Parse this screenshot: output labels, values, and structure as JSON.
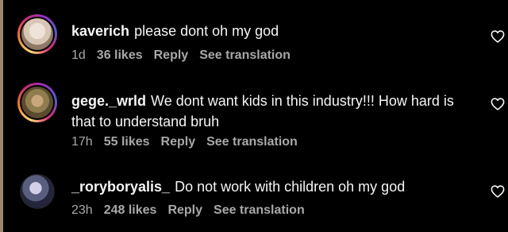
{
  "comments": [
    {
      "username": "kaverich",
      "text": "please dont oh my god",
      "time": "1d",
      "likes": "36 likes",
      "reply": "Reply",
      "translate": "See translation"
    },
    {
      "username": "gege._wrld",
      "text": "We dont want kids in this industry!!! How hard is that to understand bruh",
      "time": "17h",
      "likes": "55 likes",
      "reply": "Reply",
      "translate": "See translation"
    },
    {
      "username": "_roryboryalis_",
      "text": "Do not work with children oh my god",
      "time": "23h",
      "likes": "248 likes",
      "reply": "Reply",
      "translate": "See translation"
    }
  ],
  "icons": {
    "like": "heart-outline-icon"
  },
  "colors": {
    "background": "#000000",
    "text": "#f5f5f5",
    "meta": "#a8a8a8"
  }
}
